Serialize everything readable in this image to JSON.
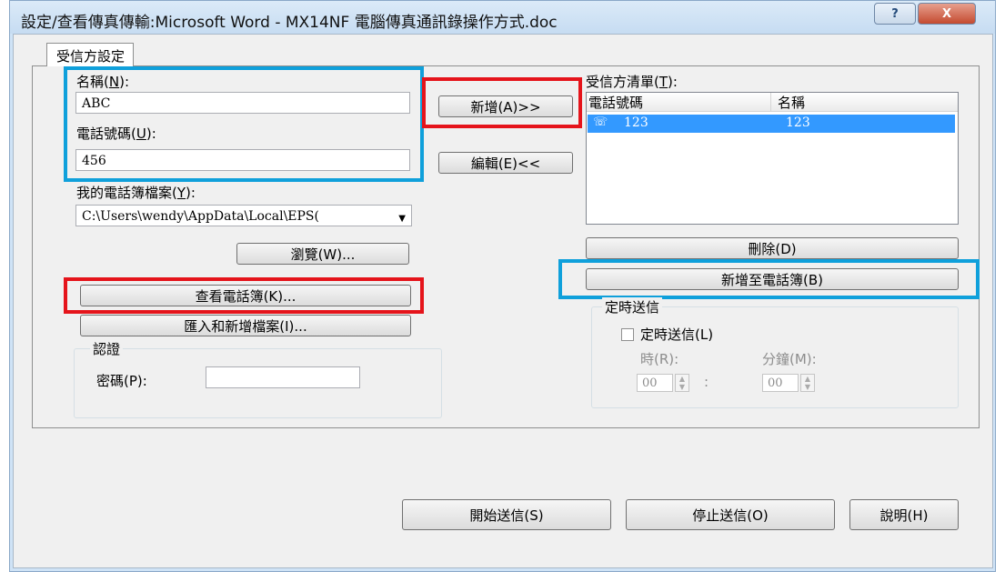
{
  "window": {
    "title": "設定/查看傳真傳輸:Microsoft Word - MX14NF 電腦傳真通訊錄操作方式.doc",
    "help_button": "?",
    "close_button": "X"
  },
  "tab": {
    "label": "受信方設定"
  },
  "form": {
    "name_label": "名稱",
    "name_key": "N",
    "name_value": "ABC",
    "phone_label": "電話號碼",
    "phone_key": "U",
    "phone_value": "456",
    "phonebook_label": "我的電話簿檔案",
    "phonebook_key": "Y",
    "phonebook_value": "C:\\Users\\wendy\\AppData\\Local\\EPS(",
    "browse_button": "瀏覽(W)...",
    "view_phonebook_button": "查看電話簿(K)...",
    "import_button": "匯入和新增檔案(I)..."
  },
  "middle": {
    "add_button": "新增(A)>>",
    "edit_button": "編輯(E)<<"
  },
  "auth": {
    "group_title": "認證",
    "password_label": "密碼(P):",
    "password_value": ""
  },
  "recipients": {
    "label": "受信方清單",
    "label_key": "T",
    "columns": [
      "電話號碼",
      "名稱"
    ],
    "rows": [
      {
        "phone": "123",
        "name": "123"
      }
    ],
    "delete_button": "刪除(D)",
    "add_to_phonebook_button": "新增至電話簿(B)"
  },
  "schedule": {
    "group_title": "定時送信",
    "checkbox_label": "定時送信(L)",
    "checked": false,
    "hour_label": "時(R):",
    "minute_label": "分鐘(M):",
    "hour_value": "00",
    "minute_value": "00",
    "separator": ":"
  },
  "footer": {
    "start_button": "開始送信(S)",
    "stop_button": "停止送信(O)",
    "help_button": "說明(H)"
  },
  "colors": {
    "highlight_red": "#e5141b",
    "highlight_blue": "#0fa0db",
    "selection": "#3399ff"
  }
}
